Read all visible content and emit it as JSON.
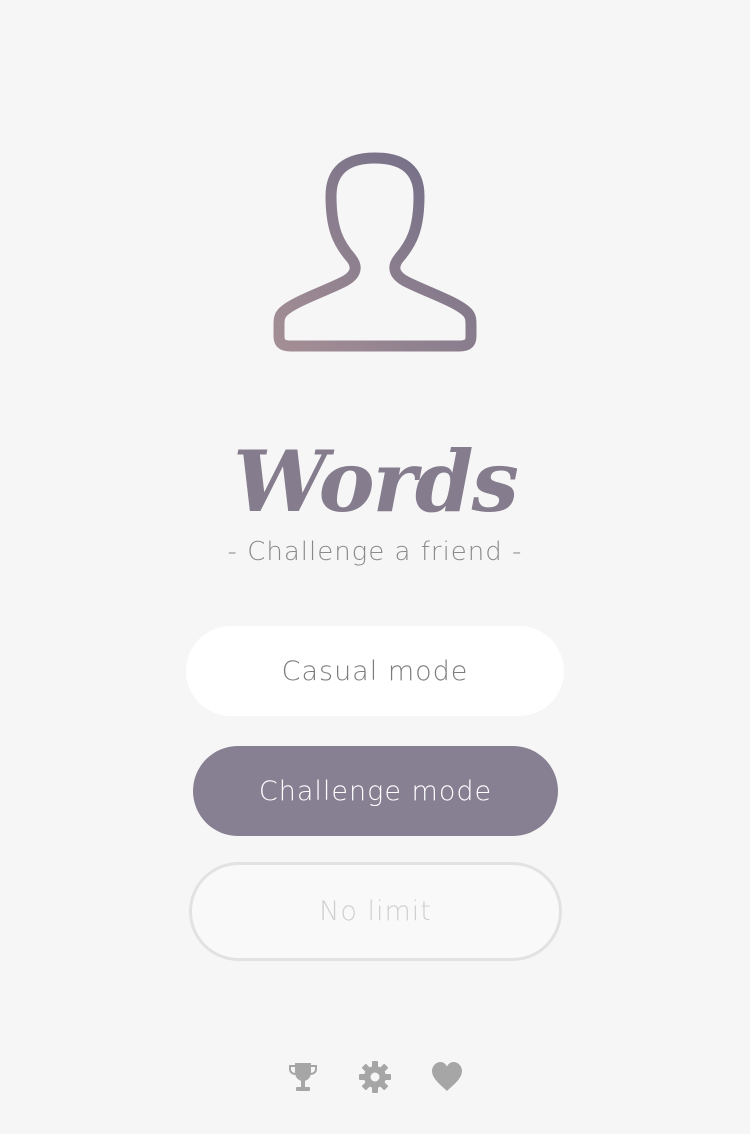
{
  "app": {
    "title": "Words",
    "subtitle": "- Challenge a friend -"
  },
  "avatar": {
    "icon": "user-silhouette-icon"
  },
  "modes": {
    "casual_label": "Casual mode",
    "challenge_label": "Challenge mode",
    "nolimit_label": "No limit"
  },
  "footer": {
    "icons": [
      "trophy-icon",
      "gear-icon",
      "heart-icon"
    ]
  },
  "colors": {
    "background": "#f6f6f6",
    "accent": "#877f92",
    "title": "#857c8e",
    "icon_gray": "#a6a6a6",
    "avatar_gradient": [
      "#a48e95",
      "#6f6c86"
    ]
  }
}
